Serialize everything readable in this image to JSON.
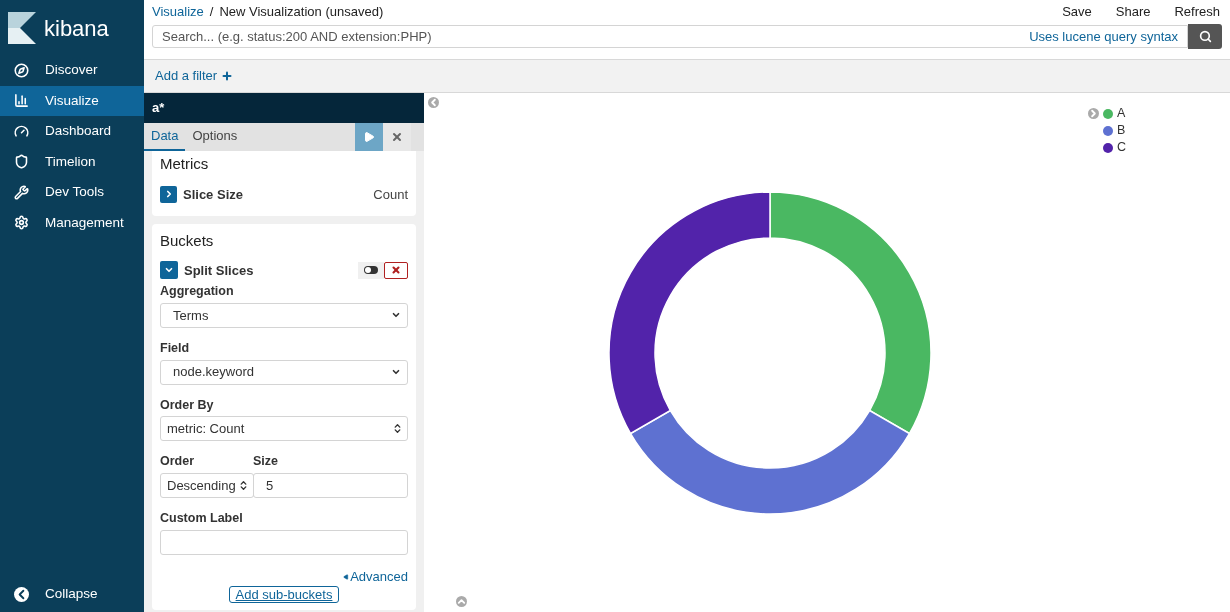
{
  "sidebar": {
    "logo": "kibana",
    "items": [
      {
        "label": "Discover",
        "selected": false
      },
      {
        "label": "Visualize",
        "selected": true
      },
      {
        "label": "Dashboard",
        "selected": false
      },
      {
        "label": "Timelion",
        "selected": false
      },
      {
        "label": "Dev Tools",
        "selected": false
      },
      {
        "label": "Management",
        "selected": false
      }
    ],
    "collapse": "Collapse"
  },
  "header": {
    "breadcrumb": {
      "parent": "Visualize",
      "separator": "/",
      "current": "New Visualization (unsaved)"
    },
    "actions": [
      "Save",
      "Share",
      "Refresh"
    ],
    "search": {
      "placeholder": "Search... (e.g. status:200 AND extension:PHP)",
      "syntax_link": "Uses lucene query syntax"
    },
    "add_filter": "Add a filter"
  },
  "editor": {
    "index": "a*",
    "tabs": [
      {
        "label": "Data",
        "selected": true
      },
      {
        "label": "Options",
        "selected": false
      }
    ],
    "metrics": {
      "title": "Metrics",
      "agg": {
        "label": "Slice Size",
        "value": "Count",
        "expanded": false
      }
    },
    "buckets": {
      "title": "Buckets",
      "agg": {
        "label": "Split Slices",
        "expanded": true,
        "enabled": true
      },
      "rows": [
        [
          {
            "kind": "select",
            "label": "Aggregation",
            "value": "Terms"
          }
        ],
        [
          {
            "kind": "select",
            "label": "Field",
            "value": "node.keyword"
          }
        ],
        [
          {
            "kind": "spinner",
            "label": "Order By",
            "value": "metric: Count"
          }
        ],
        [
          {
            "kind": "spinner",
            "label": "Order",
            "value": "Descending"
          },
          {
            "kind": "input",
            "label": "Size",
            "value": "5"
          }
        ],
        [
          {
            "kind": "input",
            "label": "Custom Label"
          }
        ]
      ],
      "advanced": "Advanced",
      "add_button": "Add sub-buckets"
    }
  },
  "chart": {
    "legend": [
      {
        "label": "A",
        "color": "#4ab862"
      },
      {
        "label": "B",
        "color": "#5e71d1"
      },
      {
        "label": "C",
        "color": "#5223aa"
      }
    ]
  }
}
